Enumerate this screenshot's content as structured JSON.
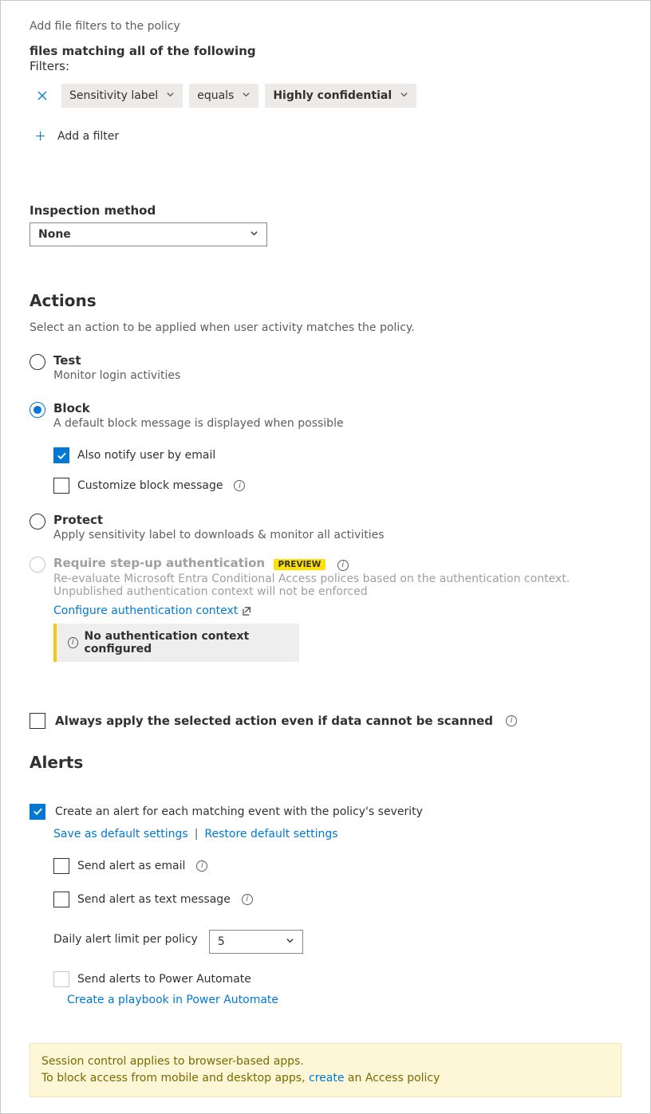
{
  "header_hint": "Add file filters to the policy",
  "filters": {
    "title": "files matching all of the following",
    "sub": "Filters:",
    "row": {
      "field": "Sensitivity label",
      "op": "equals",
      "value": "Highly confidential"
    },
    "add": "Add a filter"
  },
  "inspection": {
    "label": "Inspection method",
    "value": "None"
  },
  "actions": {
    "heading": "Actions",
    "desc": "Select an action to be applied when user activity matches the policy.",
    "test": {
      "label": "Test",
      "desc": "Monitor login activities"
    },
    "block": {
      "label": "Block",
      "desc": "A default block message is displayed when possible",
      "notify": "Also notify user by email",
      "customize": "Customize block message"
    },
    "protect": {
      "label": "Protect",
      "desc": "Apply sensitivity label to downloads & monitor all activities"
    },
    "stepup": {
      "label": "Require step-up authentication",
      "preview": "PREVIEW",
      "desc": "Re-evaluate Microsoft Entra Conditional Access polices based on the authentication context. Unpublished authentication context will not be enforced",
      "link": "Configure authentication context",
      "warn": "No authentication context configured"
    },
    "always_apply": "Always apply the selected action even if data cannot be scanned"
  },
  "alerts": {
    "heading": "Alerts",
    "create": "Create an alert for each matching event with the policy's severity",
    "save_default": "Save as default settings",
    "restore_default": "Restore default settings",
    "send_email": "Send alert as email",
    "send_text": "Send alert as text message",
    "daily_label": "Daily alert limit per policy",
    "daily_value": "5",
    "power_auto": "Send alerts to Power Automate",
    "playbook": "Create a playbook in Power Automate"
  },
  "footer": {
    "line1": "Session control applies to browser-based apps.",
    "line2a": "To block access from mobile and desktop apps, ",
    "link": "create",
    "line2b": " an Access policy"
  }
}
